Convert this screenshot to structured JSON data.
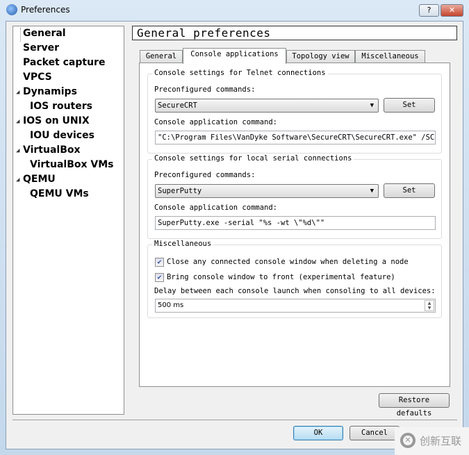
{
  "window": {
    "title": "Preferences",
    "help": "?",
    "close": "✕"
  },
  "sidebar": {
    "items": [
      {
        "label": "General",
        "expandable": false
      },
      {
        "label": "Server",
        "expandable": false
      },
      {
        "label": "Packet capture",
        "expandable": false
      },
      {
        "label": "VPCS",
        "expandable": false
      },
      {
        "label": "Dynamips",
        "expandable": true
      },
      {
        "label": "IOS routers",
        "expandable": false
      },
      {
        "label": "IOS on UNIX",
        "expandable": true
      },
      {
        "label": "IOU devices",
        "expandable": false
      },
      {
        "label": "VirtualBox",
        "expandable": true
      },
      {
        "label": "VirtualBox VMs",
        "expandable": false
      },
      {
        "label": "QEMU",
        "expandable": true
      },
      {
        "label": "QEMU VMs",
        "expandable": false
      }
    ]
  },
  "header": {
    "title": "General preferences"
  },
  "tabs": [
    {
      "label": "General"
    },
    {
      "label": "Console applications",
      "active": true
    },
    {
      "label": "Topology view"
    },
    {
      "label": "Miscellaneous"
    }
  ],
  "telnet": {
    "group": "Console settings for Telnet connections",
    "preconf_label": "Preconfigured commands:",
    "preconf_value": "SecureCRT",
    "set": "Set",
    "cmd_label": "Console application command:",
    "cmd_value": "\"C:\\Program Files\\VanDyke Software\\SecureCRT\\SecureCRT.exe\" /SCRIPT"
  },
  "serial": {
    "group": "Console settings for local serial connections",
    "preconf_label": "Preconfigured commands:",
    "preconf_value": "SuperPutty",
    "set": "Set",
    "cmd_label": "Console application command:",
    "cmd_value": "SuperPutty.exe -serial \"%s -wt \\\"%d\\\"\""
  },
  "misc": {
    "group": "Miscellaneous",
    "close_console": {
      "label": "Close any connected console window when deleting a node",
      "checked": true
    },
    "bring_front": {
      "label": "Bring console window to front (experimental feature)",
      "checked": true
    },
    "delay_label": "Delay between each console launch when consoling to all devices:",
    "delay_value": "500 ms"
  },
  "buttons": {
    "restore": "Restore defaults",
    "ok": "OK",
    "cancel": "Cancel"
  },
  "watermark": "创新互联"
}
